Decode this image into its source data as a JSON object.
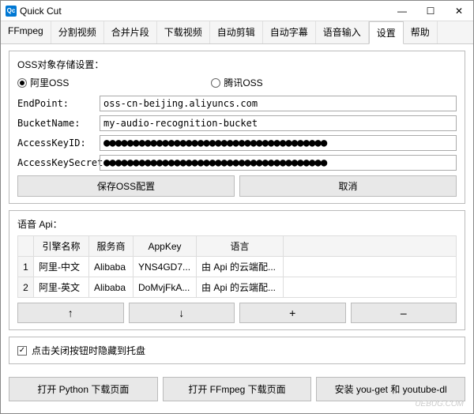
{
  "app": {
    "icon_text": "Qc",
    "title": "Quick Cut"
  },
  "tabs": {
    "t0": "FFmpeg",
    "t1": "分割视频",
    "t2": "合并片段",
    "t3": "下载视频",
    "t4": "自动剪辑",
    "t5": "自动字幕",
    "t6": "语音输入",
    "t7": "设置",
    "t8": "帮助"
  },
  "oss": {
    "title": "OSS对象存储设置：",
    "radio_ali": "阿里OSS",
    "radio_tencent": "腾讯OSS",
    "endpoint_label": "EndPoint:",
    "endpoint_value": "oss-cn-beijing.aliyuncs.com",
    "bucket_label": "BucketName:",
    "bucket_value": "my-audio-recognition-bucket",
    "keyid_label": "AccessKeyID:",
    "keyid_value": "●●●●●●●●●●●●●●●●●●●●●●●●●●●●●●●●●●●●●●",
    "secret_label": "AccessKeySecret:",
    "secret_value": "●●●●●●●●●●●●●●●●●●●●●●●●●●●●●●●●●●●●●●",
    "save_btn": "保存OSS配置",
    "cancel_btn": "取消"
  },
  "api": {
    "title": "语音 Api：",
    "headers": {
      "name": "引擎名称",
      "provider": "服务商",
      "appkey": "AppKey",
      "lang": "语言"
    },
    "rows": [
      {
        "num": "1",
        "name": "阿里-中文",
        "provider": "Alibaba",
        "appkey": "YNS4GD7...",
        "lang": "由 Api 的云端配..."
      },
      {
        "num": "2",
        "name": "阿里-英文",
        "provider": "Alibaba",
        "appkey": "DoMvjFkA...",
        "lang": "由 Api 的云端配..."
      }
    ],
    "btn_up": "↑",
    "btn_down": "↓",
    "btn_add": "+",
    "btn_del": "–"
  },
  "tray": {
    "check": "✓",
    "label": "点击关闭按钮时隐藏到托盘"
  },
  "bottom": {
    "python": "打开 Python 下载页面",
    "ffmpeg": "打开 FFmpeg 下载页面",
    "install": "安装 you-get 和 youtube-dl"
  },
  "watermark": "UEBUG.COM"
}
